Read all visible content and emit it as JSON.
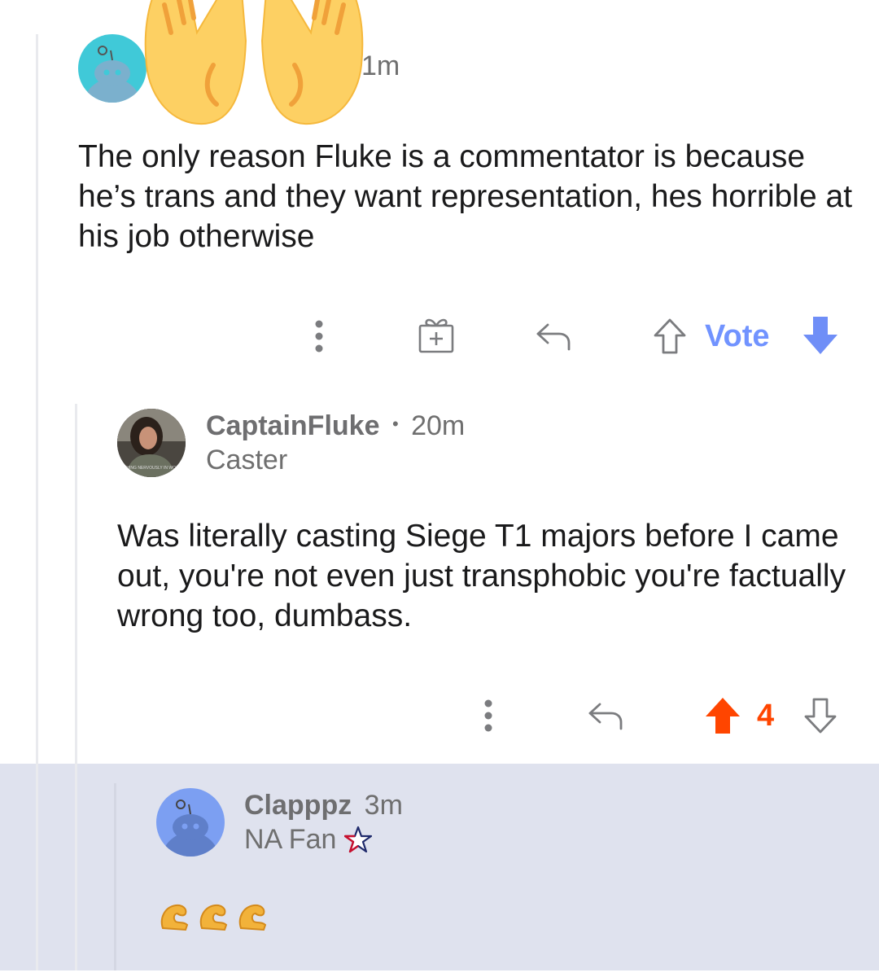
{
  "comment1": {
    "time": "1m",
    "body": "The only reason Fluke is a commentator is because he’s trans and they want representation, hes horrible at his job otherwise",
    "vote_label": "Vote",
    "icons": [
      "more-vert-icon",
      "gift-award-icon",
      "reply-icon",
      "upvote-outline-icon",
      "downvote-filled-icon"
    ]
  },
  "comment2": {
    "username": "CaptainFluke",
    "separator": "•",
    "time": "20m",
    "flair": "Caster",
    "body": "Was literally casting Siege T1 majors before I came out, you're not even just transphobic you're factually wrong too, dumbass.",
    "score": "4",
    "avatar_caption": "SHING NERVOUSLY IN WOO",
    "icons": [
      "more-vert-icon",
      "reply-icon",
      "upvote-filled-icon",
      "downvote-outline-icon"
    ]
  },
  "comment3": {
    "username": "Clapppz",
    "time": "3m",
    "flair": "NA Fan",
    "body_emoji": "💪💪💪",
    "icons": [
      "star-flag-icon"
    ]
  },
  "colors": {
    "accent_blue": "#7193ff",
    "upvote_orange": "#ff4500",
    "highlight_bg": "#dfe2ee",
    "icon_gray": "#7b7c7f"
  }
}
